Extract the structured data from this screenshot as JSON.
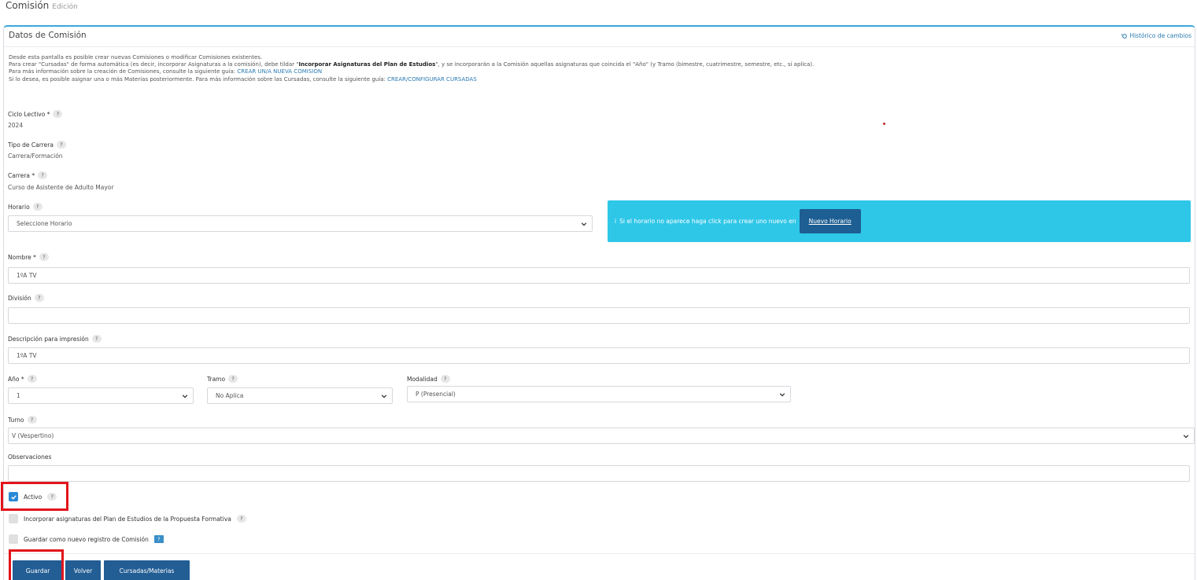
{
  "page": {
    "title": "Comisión",
    "subtitle": "Edición"
  },
  "panel": {
    "title": "Datos de Comisión",
    "history_link": "Histórico de cambios",
    "intro": {
      "line1": "Desde esta pantalla es posible crear nuevas Comisiones o modificar Comisiones existentes.",
      "line2_a": "Para crear \"Cursadas\" de forma automática (es decir, incorporar Asignaturas a la comisión), debe tildar \"",
      "line2_b": "Incorporar Asignaturas del Plan de Estudios",
      "line2_c": "\", y se incorporarán a la Comisión aquellas asignaturas que coincida el \"Año\" (y Tramo (bimestre, cuatrimestre, semestre, etc., si aplica).",
      "line3_a": "Para más información sobre la creación de Comisiones, consulte la siguiente guía: ",
      "line3_link": "CREAR UN/A NUEVA COMISION",
      "line4_a": "Si lo desea, es posible asignar una o más Materias posteriormente. Para más información sobre las Cursadas, consulte la siguiente guía: ",
      "line4_link": "CREAR/CONFIGURAR CURSADAS"
    }
  },
  "fields": {
    "ciclo_lectivo": {
      "label": "Ciclo Lectivo *",
      "value": "2024"
    },
    "tipo_carrera": {
      "label": "Tipo de Carrera",
      "value": "Carrera/Formación"
    },
    "carrera": {
      "label": "Carrera *",
      "value": "Curso de Asistente de Adulto Mayor"
    },
    "horario": {
      "label": "Horario",
      "value": "Seleccione Horario"
    },
    "nombre": {
      "label": "Nombre *",
      "value": "1ºA TV"
    },
    "division": {
      "label": "División",
      "value": ""
    },
    "descripcion": {
      "label": "Descripción para impresión",
      "value": "1ºA TV"
    },
    "anio": {
      "label": "Año *",
      "value": "1"
    },
    "tramo": {
      "label": "Tramo",
      "value": "No Aplica"
    },
    "modalidad": {
      "label": "Modalidad",
      "value": "P (Presencial)"
    },
    "turno": {
      "label": "Turno",
      "value": "V (Vespertino)"
    },
    "observaciones": {
      "label": "Observaciones",
      "value": ""
    }
  },
  "info_box": {
    "text": "Si el horario no aparece haga click para crear uno nuevo en",
    "button": "Nuevo Horario",
    "color": "#2ec7e8"
  },
  "checkboxes": {
    "activo": {
      "label": "Activo",
      "checked": true
    },
    "incorporar": {
      "label": "Incorporar asignaturas del Plan de Estudios de la Propuesta Formativa",
      "checked": false
    },
    "guardar_nuevo": {
      "label": "Guardar como nuevo registro de Comisión",
      "checked": false
    }
  },
  "buttons": {
    "guardar": "Guardar",
    "volver": "Volver",
    "cursadas": "Cursadas/Materias"
  },
  "help_glyph": "?",
  "info_glyph": "i",
  "colors": {
    "primary": "#225d94",
    "accent": "#3aa9d8",
    "highlight": "#e3141b"
  }
}
